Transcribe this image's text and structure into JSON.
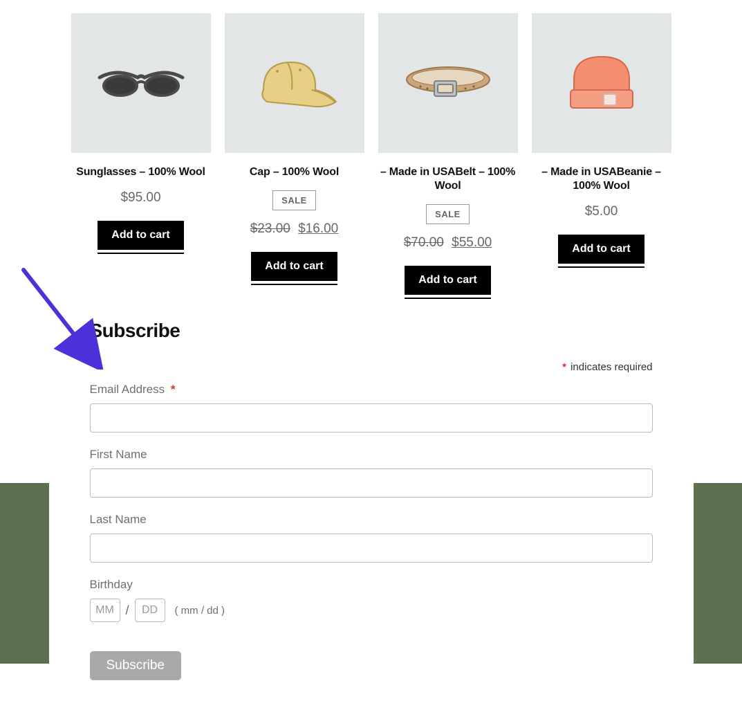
{
  "products": [
    {
      "title": "Sunglasses – 100% Wool",
      "price_current": "$95.00",
      "price_original": "",
      "badge": "",
      "button": "Add to cart",
      "icon": "sunglasses"
    },
    {
      "title": "Cap – 100% Wool",
      "price_current": "$16.00",
      "price_original": "$23.00",
      "badge": "SALE",
      "button": "Add to cart",
      "icon": "cap"
    },
    {
      "title": "– Made in USABelt – 100% Wool",
      "price_current": "$55.00",
      "price_original": "$70.00",
      "badge": "SALE",
      "button": "Add to cart",
      "icon": "belt"
    },
    {
      "title": "– Made in USABeanie – 100% Wool",
      "price_current": "$5.00",
      "price_original": "",
      "badge": "",
      "button": "Add to cart",
      "icon": "beanie"
    }
  ],
  "subscribe": {
    "heading": "Subscribe",
    "indicates_required": "indicates required",
    "star": "*",
    "email_label": "Email Address",
    "first_name_label": "First Name",
    "last_name_label": "Last Name",
    "birthday_label": "Birthday",
    "mm_placeholder": "MM",
    "dd_placeholder": "DD",
    "slash": "/",
    "birthday_hint": "( mm / dd )",
    "subscribe_button": "Subscribe"
  }
}
